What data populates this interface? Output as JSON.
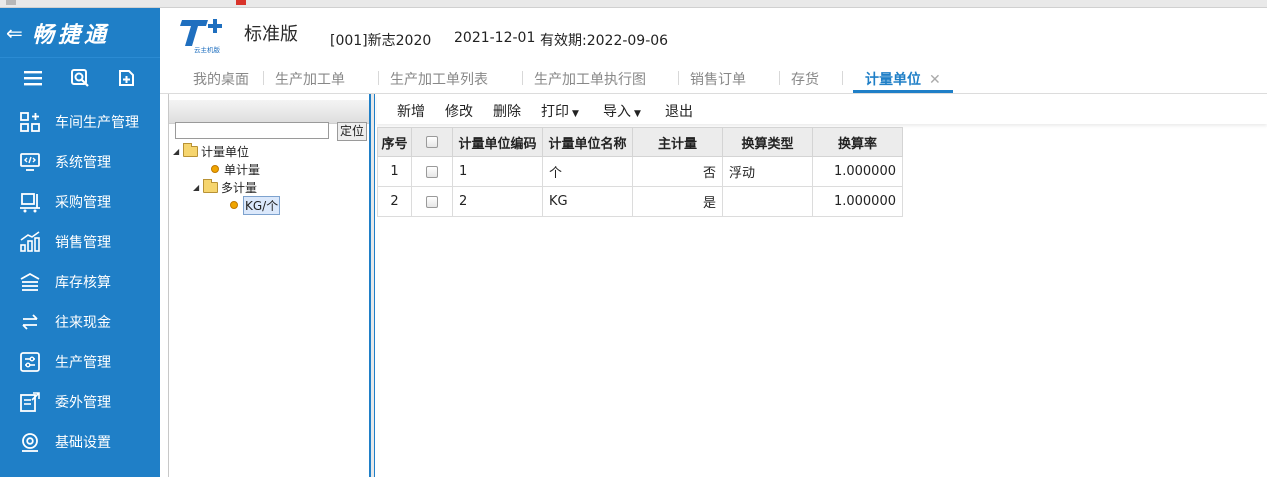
{
  "app": {
    "name": "畅捷通",
    "edition": "标准版",
    "logo_text": "云主机版",
    "account": "[001]新志2020",
    "date": "2021-12-01",
    "validity": "有效期:2022-09-06",
    "accent_color": "#1f7fc7"
  },
  "sidebar": {
    "tools": [
      {
        "icon": "menu-icon"
      },
      {
        "icon": "search-icon"
      },
      {
        "icon": "add-page-icon"
      }
    ],
    "items": [
      {
        "label": "车间生产管理",
        "icon": "workshop-icon"
      },
      {
        "label": "系统管理",
        "icon": "system-icon"
      },
      {
        "label": "采购管理",
        "icon": "purchase-icon"
      },
      {
        "label": "销售管理",
        "icon": "sales-chart-icon"
      },
      {
        "label": "库存核算",
        "icon": "inventory-icon"
      },
      {
        "label": "往来现金",
        "icon": "exchange-icon"
      },
      {
        "label": "生产管理",
        "icon": "production-icon"
      },
      {
        "label": "委外管理",
        "icon": "outsource-icon"
      },
      {
        "label": "基础设置",
        "icon": "settings-icon"
      }
    ]
  },
  "tabs": [
    {
      "label": "我的桌面"
    },
    {
      "label": "生产加工单"
    },
    {
      "label": "生产加工单列表"
    },
    {
      "label": "生产加工单执行图"
    },
    {
      "label": "销售订单"
    },
    {
      "label": "存货"
    },
    {
      "label": "计量单位",
      "active": true,
      "close": "✕"
    }
  ],
  "tree": {
    "search_value": "",
    "locate_label": "定位",
    "nodes": [
      {
        "label": "计量单位",
        "type": "folder",
        "level": 0
      },
      {
        "label": "单计量",
        "type": "leaf",
        "level": 1
      },
      {
        "label": "多计量",
        "type": "folder",
        "level": 1
      },
      {
        "label": "KG/个",
        "type": "leaf",
        "level": 2,
        "selected": true
      }
    ]
  },
  "toolbar": {
    "new": "新增",
    "edit": "修改",
    "delete": "删除",
    "print": "打印",
    "import": "导入",
    "exit": "退出"
  },
  "grid": {
    "columns": [
      "序号",
      "",
      "计量单位编码",
      "计量单位名称",
      "主计量",
      "换算类型",
      "换算率"
    ],
    "rows": [
      {
        "seq": "1",
        "code": "1",
        "name": "个",
        "main": "否",
        "conv_type": "浮动",
        "rate": "1.000000"
      },
      {
        "seq": "2",
        "code": "2",
        "name": "KG",
        "main": "是",
        "conv_type": "",
        "rate": "1.000000"
      }
    ]
  }
}
